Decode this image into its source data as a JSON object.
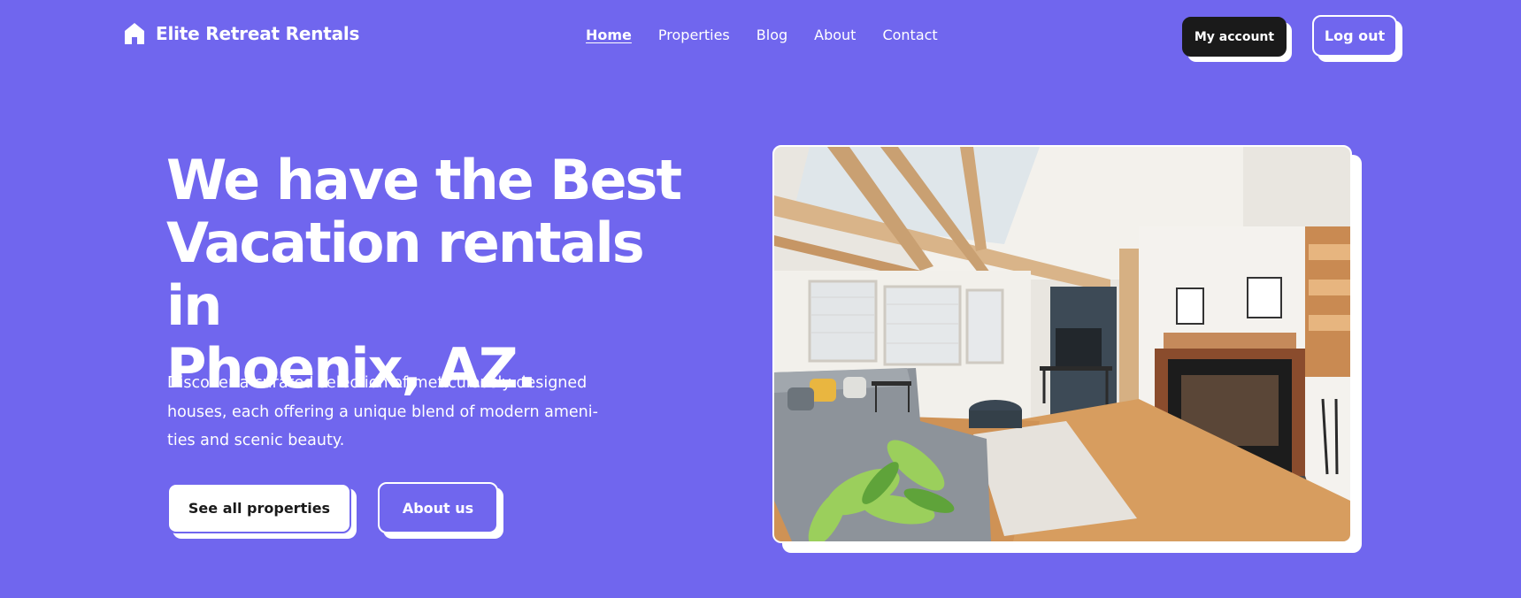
{
  "header": {
    "brand": "Elite Retreat Rentals",
    "brand_icon": "home-icon",
    "nav": [
      {
        "label": "Home",
        "active": true
      },
      {
        "label": "Properties",
        "active": false
      },
      {
        "label": "Blog",
        "active": false
      },
      {
        "label": "About",
        "active": false
      },
      {
        "label": "Contact",
        "active": false
      }
    ],
    "my_account_label": "My account",
    "logout_label": "Log out"
  },
  "hero": {
    "title_lines": [
      "We have the Best",
      "Vacation rentals in",
      "Phoenix, AZ."
    ],
    "description_lines": [
      "Discover a curated selection of meticulously designed",
      "houses, each offering a unique blend of modern ameni-",
      "ties and scenic beauty."
    ],
    "primary_button": "See all properties",
    "secondary_button": "About us",
    "image_subject": "living-room-photo"
  },
  "colors": {
    "background": "#7066EE",
    "text": "#FFFFFF",
    "dark_button": "#1A1A1A"
  }
}
